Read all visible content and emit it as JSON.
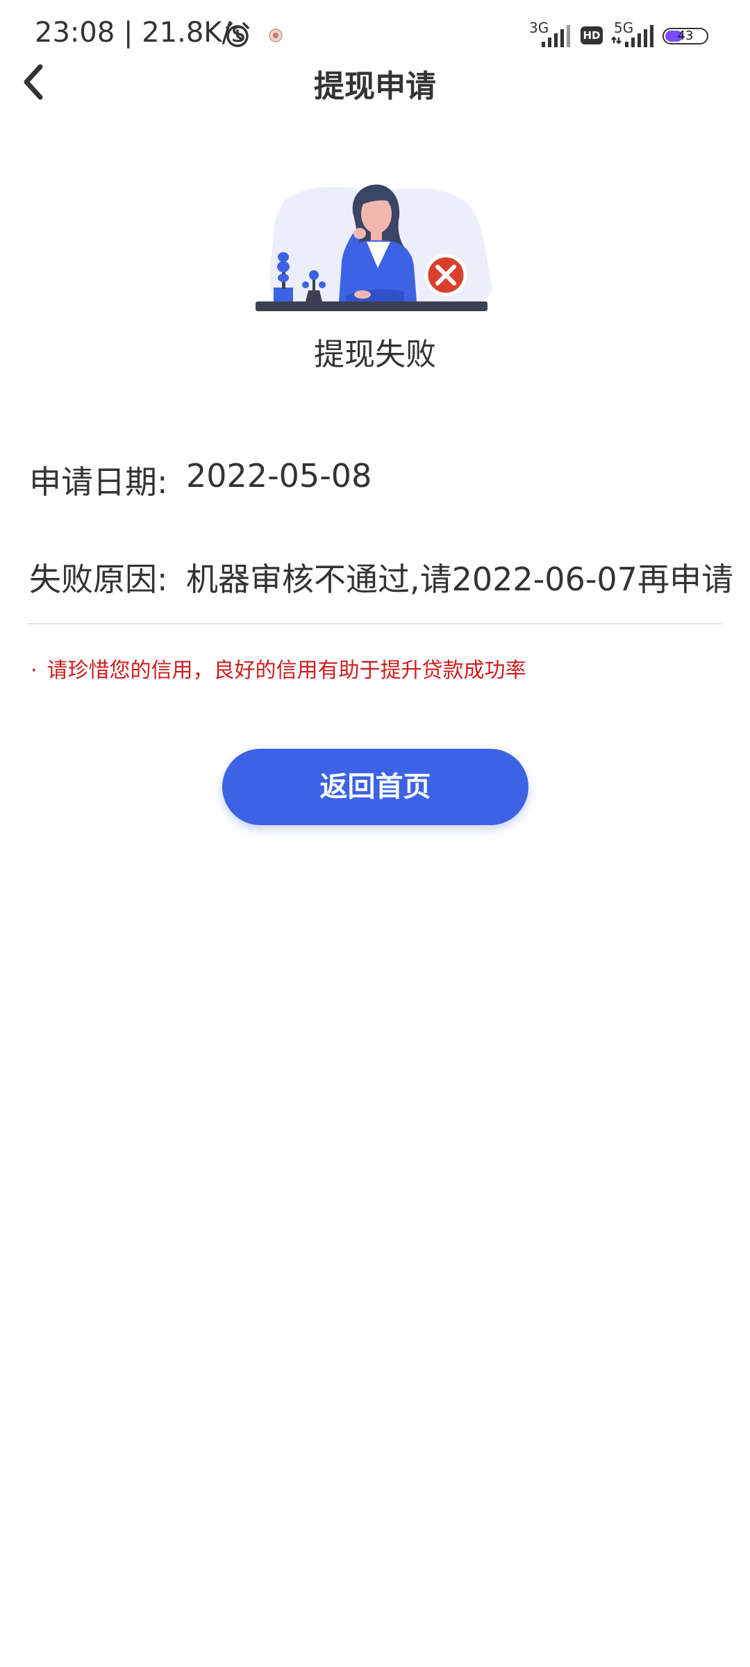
{
  "status_bar": {
    "time": "23:08",
    "net_speed": "21.8K/s",
    "net_3g": "3G",
    "hd": "HD",
    "net_5g": "5G",
    "battery": "43",
    "icons": [
      "alarm-icon",
      "app-badge-icon",
      "signal-icon",
      "battery-icon"
    ],
    "battery_level": 0.43
  },
  "header": {
    "back_icon": "back-chevron-icon",
    "title": "提现申请"
  },
  "result": {
    "illustration": "withdrawal-failed-illustration",
    "title": "提现失败"
  },
  "details": [
    {
      "label": "申请日期:",
      "value": "2022-05-08"
    },
    {
      "label": "失败原因:",
      "value": "机器审核不通过,请2022-06-07再申请"
    }
  ],
  "notice": {
    "bullet": "·",
    "text": "请珍惜您的信用，良好的信用有助于提升贷款成功率"
  },
  "actions": {
    "home_button": "返回首页"
  },
  "colors": {
    "primary": "#3d63e4",
    "notice": "#cc1c1c",
    "text": "#333333",
    "error": "#d9402b"
  }
}
